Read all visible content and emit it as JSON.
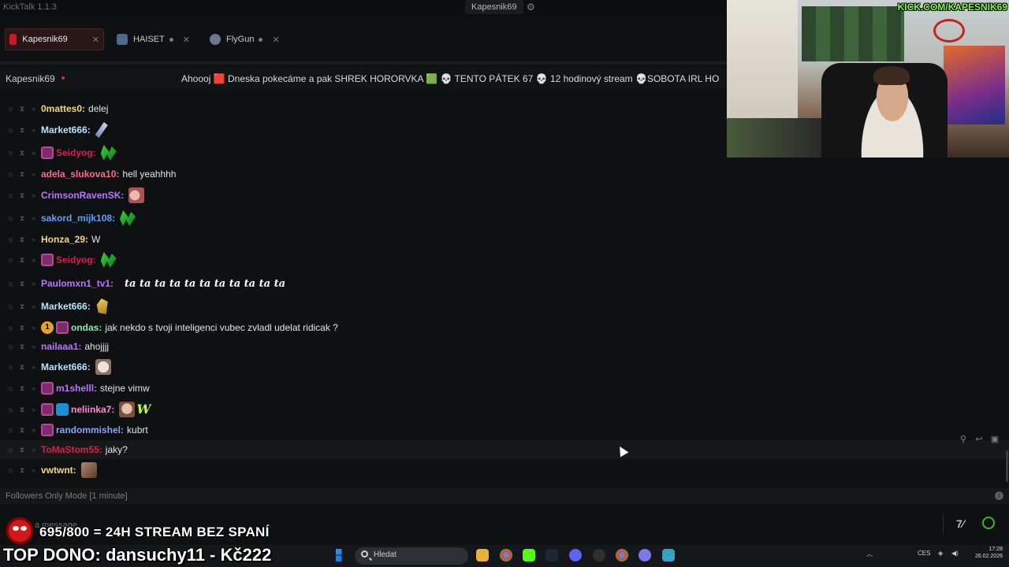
{
  "app": {
    "title": "KickTalk 1.1.3",
    "titlebar_user": "Kapesnik69"
  },
  "tabs": [
    {
      "label": "Kapesnik69",
      "active": true
    },
    {
      "label": "HAISET",
      "active": false
    },
    {
      "label": "FlyGun",
      "active": false
    }
  ],
  "channel": {
    "name": "Kapesnik69",
    "ticker": "Ahoooj 🟥 Dneska pokecáme a pak SHREK HORORVKA 🟩 💀 TENTO PÁTEK 67 💀 12 hodinový stream 💀SOBOTA IRL HO"
  },
  "messages": [
    {
      "user": "0mattes0",
      "color": "#f2d784",
      "text": "delej",
      "badges": [],
      "emotes": []
    },
    {
      "user": "Market666",
      "color": "#b8e0ff",
      "text": "",
      "badges": [],
      "emotes": [
        "brush"
      ]
    },
    {
      "user": "Seidyog",
      "color": "#d6204a",
      "text": "",
      "badges": [
        "sub"
      ],
      "emotes": [
        "green"
      ]
    },
    {
      "user": "adela_slukova10",
      "color": "#ff6b8a",
      "text": "hell yeahhhh",
      "badges": [],
      "emotes": []
    },
    {
      "user": "CrimsonRavenSK",
      "color": "#b877ff",
      "text": "",
      "badges": [],
      "emotes": [
        "pig"
      ]
    },
    {
      "user": "sakord_mijk108",
      "color": "#5aa0ff",
      "text": "",
      "badges": [],
      "emotes": [
        "green"
      ]
    },
    {
      "user": "Honza_29",
      "color": "#f2d784",
      "text": "W",
      "badges": [],
      "emotes": []
    },
    {
      "user": "Seidyog",
      "color": "#d6204a",
      "text": "",
      "badges": [
        "sub"
      ],
      "emotes": [
        "green"
      ]
    },
    {
      "user": "Paulomxn1_tv1",
      "color": "#b877ff",
      "text": "",
      "badges": [],
      "emotes": [],
      "spam": "ta ta ta ta ta ta ta ta ta ta ta"
    },
    {
      "user": "Market666",
      "color": "#b8e0ff",
      "text": "",
      "badges": [],
      "emotes": [
        "corn"
      ]
    },
    {
      "user": "ondas",
      "color": "#8ce8b0",
      "text": "jak nekdo s tvoji inteligenci vubec zvladl udelat ridicak ?",
      "badges": [
        "num",
        "sub"
      ],
      "emotes": []
    },
    {
      "user": "nailaaa1",
      "color": "#b877ff",
      "text": "ahojjjj",
      "badges": [],
      "emotes": []
    },
    {
      "user": "Market666",
      "color": "#b8e0ff",
      "text": "",
      "badges": [],
      "emotes": [
        "pale"
      ]
    },
    {
      "user": "m1shelll",
      "color": "#b877ff",
      "text": "stejne vimw",
      "badges": [
        "sub"
      ],
      "emotes": []
    },
    {
      "user": "neliinka7",
      "color": "#ff8ad8",
      "text": "",
      "badges": [
        "sub",
        "gift"
      ],
      "emotes": [
        "face",
        "w"
      ]
    },
    {
      "user": "randommishel",
      "color": "#8aa0ff",
      "text": "kubrt",
      "badges": [
        "sub"
      ],
      "emotes": []
    },
    {
      "user": "ToMaStom55",
      "color": "#d6204a",
      "text": "jaky?",
      "badges": [],
      "emotes": []
    },
    {
      "user": "vwtwnt",
      "color": "#f2d784",
      "text": "",
      "badges": [],
      "emotes": [
        "img2"
      ]
    }
  ],
  "chat_mode": "Followers Only Mode [1 minute]",
  "input": {
    "placeholder": "a message..."
  },
  "overlay": {
    "goal": "695/800 = 24H STREAM BEZ SPANÍ",
    "top_dono": "TOP DONO: dansuchy11 - Kč222",
    "cam_url": "KICK.COM/KAPESNIK69"
  },
  "taskbar": {
    "search_placeholder": "Hledat",
    "lang": "CES",
    "time": "17:28",
    "date": "26.02.2026"
  },
  "colors": {
    "accent": "#c33",
    "kick_green": "#53fc18"
  }
}
